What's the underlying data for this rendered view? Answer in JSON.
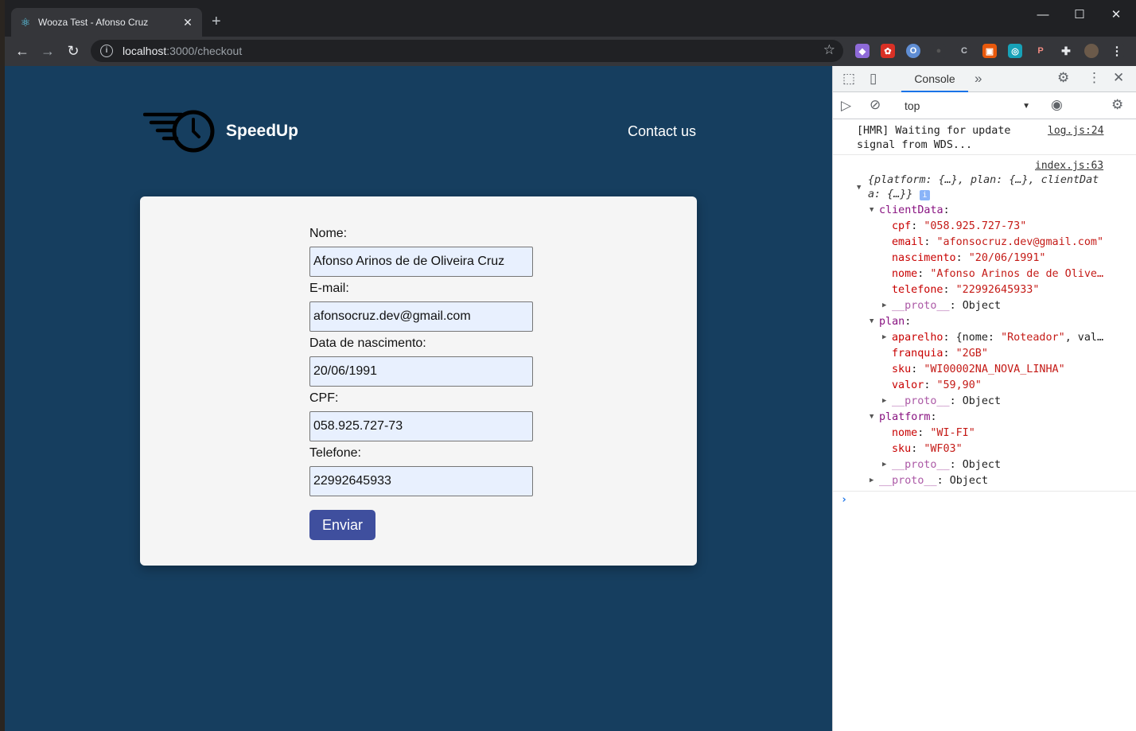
{
  "browser": {
    "tab_title": "Wooza Test - Afonso Cruz",
    "tab_favicon": "react-icon",
    "url_host": "localhost",
    "url_path": ":3000/checkout"
  },
  "site": {
    "brand": "SpeedUp",
    "contact": "Contact us"
  },
  "form": {
    "fields": [
      {
        "label": "Nome:",
        "value": "Afonso Arinos de de Oliveira Cruz"
      },
      {
        "label": "E-mail:",
        "value": "afonsocruz.dev@gmail.com"
      },
      {
        "label": "Data de nascimento:",
        "value": "20/06/1991"
      },
      {
        "label": "CPF:",
        "value": "058.925.727-73"
      },
      {
        "label": "Telefone:",
        "value": "22992645933"
      }
    ],
    "submit": "Enviar"
  },
  "devtools": {
    "tab": "Console",
    "context": "top",
    "hmr_line1": "[HMR] Waiting for update",
    "hmr_line2": "signal from WDS...",
    "hmr_src": "log.js:24",
    "obj_src": "index.js:63",
    "obj_summary1": "{platform: {…}, plan: {…}, clientDat",
    "obj_summary2": "a: {…}}",
    "clientData_key": "clientData",
    "cpf_key": "cpf",
    "cpf_val": "\"058.925.727-73\"",
    "email_key": "email",
    "email_val": "\"afonsocruz.dev@gmail.com\"",
    "nasc_key": "nascimento",
    "nasc_val": "\"20/06/1991\"",
    "nome_key": "nome",
    "nome_val": "\"Afonso Arinos de de Olive…",
    "tel_key": "telefone",
    "tel_val": "\"22992645933\"",
    "proto_key": "__proto__",
    "proto_val": "Object",
    "plan_key": "plan",
    "aparelho_key": "aparelho",
    "aparelho_pre": "{nome: ",
    "aparelho_val": "\"Roteador\"",
    "aparelho_post": ", val…",
    "franquia_key": "franquia",
    "franquia_val": "\"2GB\"",
    "sku_key": "sku",
    "plan_sku_val": "\"WI00002NA_NOVA_LINHA\"",
    "valor_key": "valor",
    "valor_val": "\"59,90\"",
    "platform_key": "platform",
    "pnome_val": "\"WI-FI\"",
    "psku_val": "\"WF03\"",
    "prompt": "›"
  }
}
